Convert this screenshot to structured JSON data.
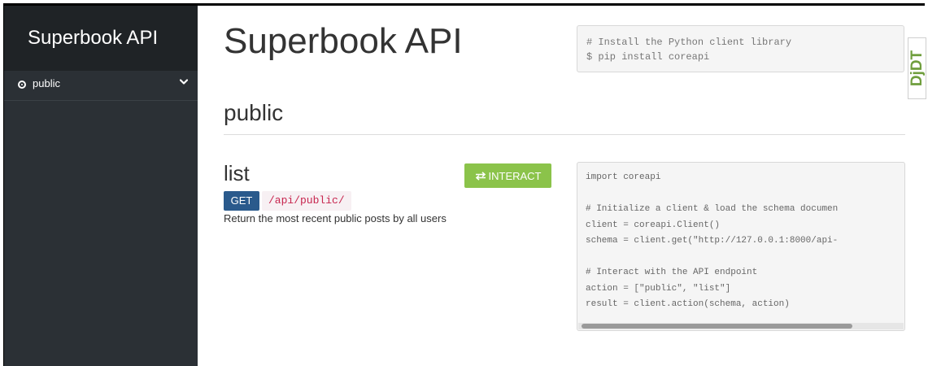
{
  "sidebar": {
    "brand": "Superbook API",
    "items": [
      {
        "label": "public",
        "icon": "radio-dot-icon",
        "chevron": "chevron-down-icon"
      }
    ]
  },
  "main": {
    "title": "Superbook API",
    "install_snippet": [
      "# Install the Python client library",
      "$ pip install coreapi"
    ],
    "section": {
      "title": "public",
      "endpoint": {
        "name": "list",
        "interact_label": "INTERACT",
        "interact_icon": "swap-arrows-icon",
        "method": "GET",
        "path": "/api/public/",
        "description": "Return the most recent public posts by all users",
        "code_lines": [
          "import coreapi",
          "",
          "# Initialize a client & load the schema documen",
          "client = coreapi.Client()",
          "schema = client.get(\"http://127.0.0.1:8000/api-",
          "",
          "# Interact with the API endpoint",
          "action = [\"public\", \"list\"]",
          "result = client.action(schema, action)"
        ]
      }
    }
  },
  "debug_toolbar": {
    "label": "DjDT"
  },
  "colors": {
    "sidebar_bg": "#2b3035",
    "brand_bg": "#1f2326",
    "interact_green": "#8bc34a",
    "get_blue": "#2a5a8c",
    "path_red": "#c7254e",
    "ddt_green": "#6f9e3d"
  }
}
